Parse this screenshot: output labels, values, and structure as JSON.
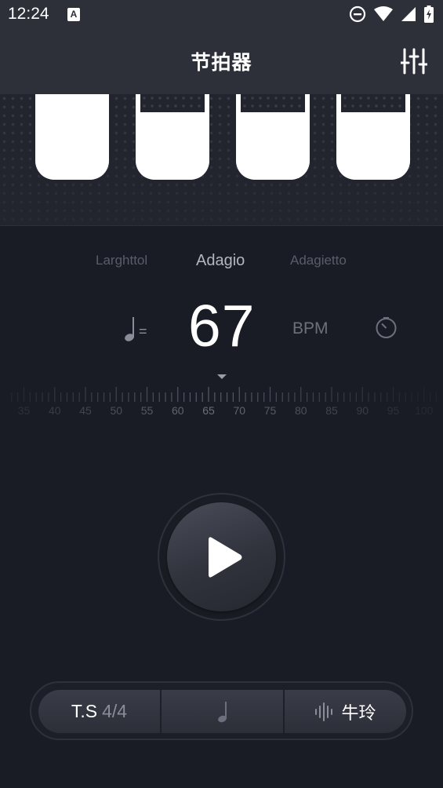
{
  "status_bar": {
    "time": "12:24",
    "notification_badge": "A",
    "icons": [
      "dnd-icon",
      "wifi-icon",
      "signal-icon",
      "battery-charging-icon"
    ]
  },
  "app_bar": {
    "title": "节拍器",
    "settings_icon": "sliders-icon"
  },
  "beats": {
    "count": 4,
    "accent_index": 0
  },
  "tempo": {
    "previous": "Larghttol",
    "current": "Adagio",
    "next": "Adagietto"
  },
  "bpm": {
    "note_icon": "quarter-note-icon",
    "equals": "=",
    "value": "67",
    "unit": "BPM",
    "timer_icon": "timer-icon"
  },
  "ruler": {
    "min": 35,
    "max": 100,
    "step": 5,
    "selected": 65,
    "labels": [
      "35",
      "40",
      "45",
      "50",
      "55",
      "60",
      "65",
      "70",
      "75",
      "80",
      "85",
      "90",
      "95",
      "100"
    ]
  },
  "controls": {
    "play_icon": "play-icon",
    "time_signature_label": "T.S",
    "time_signature_value": "4/4",
    "subdivision_icon": "quarter-note-icon",
    "sound_icon": "waveform-icon",
    "sound_label": "牛玲"
  },
  "colors": {
    "background": "#1a1c25",
    "bar": "#2d2f39",
    "beat_pad": "#ffffff"
  }
}
